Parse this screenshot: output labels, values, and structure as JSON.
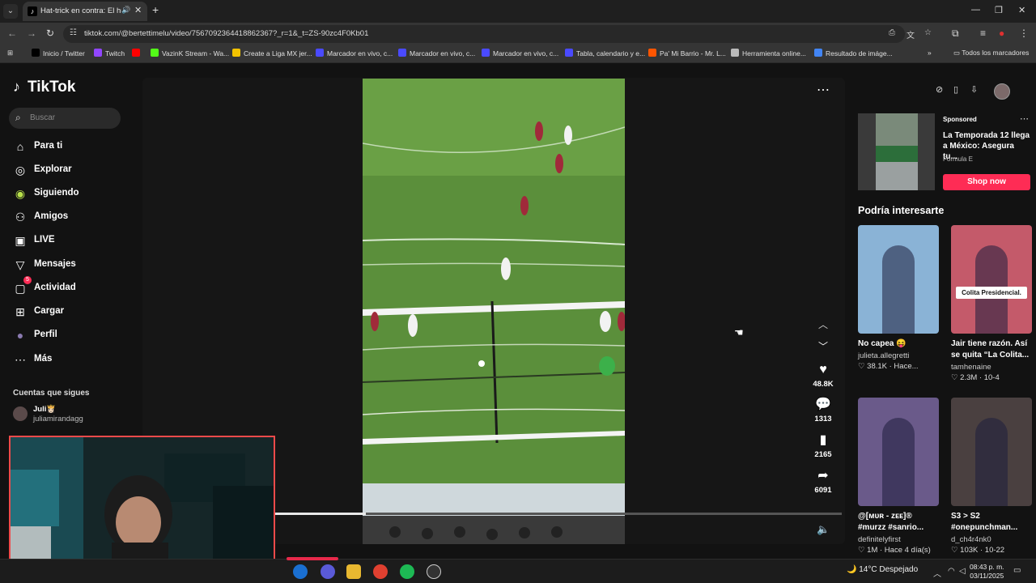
{
  "browser": {
    "tab_title": "Hat-trick en contra: El hum",
    "new_tab": "+",
    "url": "tiktok.com/@bertettimelu/video/7567092364418862367?_r=1&_t=ZS-90zc4F0Kb01",
    "bookmarks": [
      {
        "label": "Inicio / Twitter",
        "color": "#000000"
      },
      {
        "label": "Twitch",
        "color": "#9146ff"
      },
      {
        "label": "",
        "color": "#ff0000"
      },
      {
        "label": "VazinK Stream - Wa...",
        "color": "#53fc18"
      },
      {
        "label": "Create a Liga MX jer...",
        "color": "#f2c200"
      },
      {
        "label": "Marcador en vivo, c...",
        "color": "#4a4aff"
      },
      {
        "label": "Marcador en vivo, c...",
        "color": "#4a4aff"
      },
      {
        "label": "Marcador en vivo, c...",
        "color": "#4a4aff"
      },
      {
        "label": "Tabla, calendario y e...",
        "color": "#4a4aff"
      },
      {
        "label": "Pa' Mi Barrio - Mr. L...",
        "color": "#ff5500"
      },
      {
        "label": "Herramienta online...",
        "color": "#bbbbbb"
      },
      {
        "label": "Resultado de imáge...",
        "color": "#4285f4"
      }
    ],
    "all_bookmarks": "Todos los marcadores"
  },
  "tiktok": {
    "logo": "TikTok",
    "search_placeholder": "Buscar",
    "nav": [
      {
        "label": "Para ti",
        "icon": "home-icon"
      },
      {
        "label": "Explorar",
        "icon": "compass-icon"
      },
      {
        "label": "Siguiendo",
        "icon": "following-icon"
      },
      {
        "label": "Amigos",
        "icon": "friends-icon"
      },
      {
        "label": "LIVE",
        "icon": "live-icon"
      },
      {
        "label": "Mensajes",
        "icon": "messages-icon"
      },
      {
        "label": "Actividad",
        "icon": "activity-icon",
        "badge": "5"
      },
      {
        "label": "Cargar",
        "icon": "upload-icon"
      },
      {
        "label": "Perfil",
        "icon": "profile-icon"
      },
      {
        "label": "Más",
        "icon": "more-icon"
      }
    ],
    "following_title": "Cuentas que sigues",
    "following": [
      {
        "name": "Juli👸🏻",
        "handle": "juliamirandagg"
      }
    ],
    "actions": {
      "likes": "48.8K",
      "comments": "1313",
      "saves": "2165",
      "shares": "6091"
    },
    "video_progress": 0.16
  },
  "sidebar_right": {
    "sponsored_label": "Sponsored",
    "ad_title": "La Temporada 12 llega a México: Asegura tu...",
    "ad_brand": "Formula E",
    "shop_now": "Shop now",
    "rec_title": "Podría interesarte",
    "cards": [
      {
        "caption": "No capea 😝",
        "author": "julieta.allegretti",
        "meta": "♡ 38.1K · Hace...",
        "bg": "#8ab3d6"
      },
      {
        "caption": "Jair tiene razón. Así se quita “La Colita...",
        "author": "tamhenaine",
        "meta": "♡ 2.3M · 10-4",
        "bg": "#c45a6a",
        "overlay": "Colita Presidencial."
      },
      {
        "caption": "@[ᴍᴜʀ - ᴢᴇᴇ]® #murzz #sanrio...",
        "author": "definitelyfirst",
        "meta": "♡ 1M · Hace 4 día(s)",
        "bg": "#6a5a8a"
      },
      {
        "caption": "S3 > S2 #onepunchman...",
        "author": "d_ch4r4nk0",
        "meta": "♡ 103K · 10-22",
        "bg": "#4a4040"
      }
    ]
  },
  "taskbar": {
    "weather": "14°C  Despejado",
    "time": "08:43 p. m.",
    "date": "03/11/2025"
  }
}
